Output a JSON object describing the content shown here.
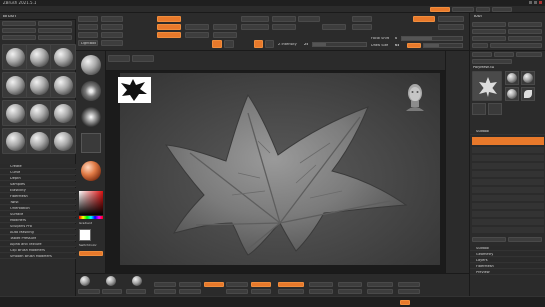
{
  "app": {
    "title": "ZBrush 2021.5.1",
    "undo_label": "Undo",
    "redo_label": "Redo"
  },
  "left_panel": {
    "header": "Brush",
    "load_button": "Load Brush",
    "clone_button": "Clone",
    "import_button": "Import"
  },
  "left_menu": [
    "Create",
    "Curve",
    "Depth",
    "Samples",
    "Elasticity",
    "FiberMesh",
    "Twist",
    "Orientation",
    "Surface",
    "Modifiers",
    "Sculptris Pro",
    "Auto Masking",
    "Tablet Pressure",
    "Alpha and Texture",
    "Clip Brush Modifiers",
    "Smooth Brush Modifiers"
  ],
  "toolbar_shelf": {
    "lightbox_button": "LightBox",
    "gradient_label": "Gradient",
    "switch_color_label": "SwitchColor",
    "alternate_label": "Alternate"
  },
  "draw_bar": {
    "draw_button": "Draw",
    "move_button": "Move",
    "scale_button": "Scale",
    "rotate_button": "Rotate",
    "zadd_button": "Zadd",
    "zsub_button": "Zsub",
    "focal_shift_label": "Focal Shift",
    "focal_shift_value": "0",
    "z_intensity_label": "Z Intensity",
    "z_intensity_value": "25",
    "draw_size_label": "Draw Size",
    "draw_size_value": "64",
    "dynamic_label": "Dynamic",
    "active_points_label": "ActivePoints",
    "active_points_value": "4,072",
    "total_points_label": "TotalPoints",
    "total_points_value": "4,072"
  },
  "right_panel": {
    "header": "Tool",
    "load_tool_button": "Load Tool",
    "save_as_button": "Save As",
    "copy_tool_label": "Copy Tool",
    "paste_tool_label": "Paste Tool",
    "import_button": "Import",
    "export_button": "Export",
    "clone_button": "Clone",
    "make_polymesh_button": "Make PolyMesh3D",
    "goz_button": "GoZ",
    "all_button": "All",
    "visible_button": "Visible",
    "lightbox_tools": "Lightbox > Tools",
    "current_tool_name": "PolyMesh3D",
    "subtool_label": "Subtool",
    "list_all_label": "List All",
    "new_folder_label": "New Folder",
    "geometry_label": "Geometry",
    "all_low_label": "All Low",
    "all_high_label": "All High"
  },
  "right_menu": [
    "Subtool",
    "Geometry",
    "Layers",
    "FiberMesh",
    "Preview"
  ],
  "bottom_bar": {
    "edit_button": "Edit",
    "perspective_button": "Persp",
    "floor_button": "Floor",
    "frame_button": "Frame",
    "move_view_button": "Move",
    "zoom3d_button": "Zoom3D",
    "rotate_view_button": "Rotate",
    "transp_button": "Transp",
    "ghost_button": "Ghost",
    "solo_button": "Solo",
    "xpose_button": "Xpose",
    "dynamesh_button": "DynaMesh",
    "resolution_label": "Resolution",
    "resolution_value": "128",
    "zremesher_button": "ZRemesher",
    "target_polygons_label": "Target Polygons",
    "target_polygons_value": "5",
    "del_hidden_button": "Del Hidden",
    "close_holes_button": "Close Holes",
    "divide_button": "Divide",
    "smt_button": "Smt",
    "sdiv_label": "SDiv",
    "sdiv_value": "1",
    "group_visible_button": "Group Visible",
    "polygroup_button": "Auto Groups",
    "polyf_button": "PolyF",
    "mask_all_button": "Mask All",
    "clear_mask_button": "Clear Mask"
  },
  "status_bar": {
    "sculptris_pro": "Sculptris Pro"
  },
  "reference_image": {
    "label": "Ivy leaf silhouette reference"
  },
  "colors": {
    "accent": "#e8792b",
    "canvas": "#4a4a4a",
    "panel": "#2b2b2b",
    "mesh": "#7e7e7e"
  },
  "icons": {
    "brush_icon": "sphere-brush-icon",
    "alpha_icon": "alpha-icon",
    "texture_icon": "texture-icon",
    "material_icon": "material-sphere-icon",
    "navigation_head": "head-navigation-icon"
  }
}
